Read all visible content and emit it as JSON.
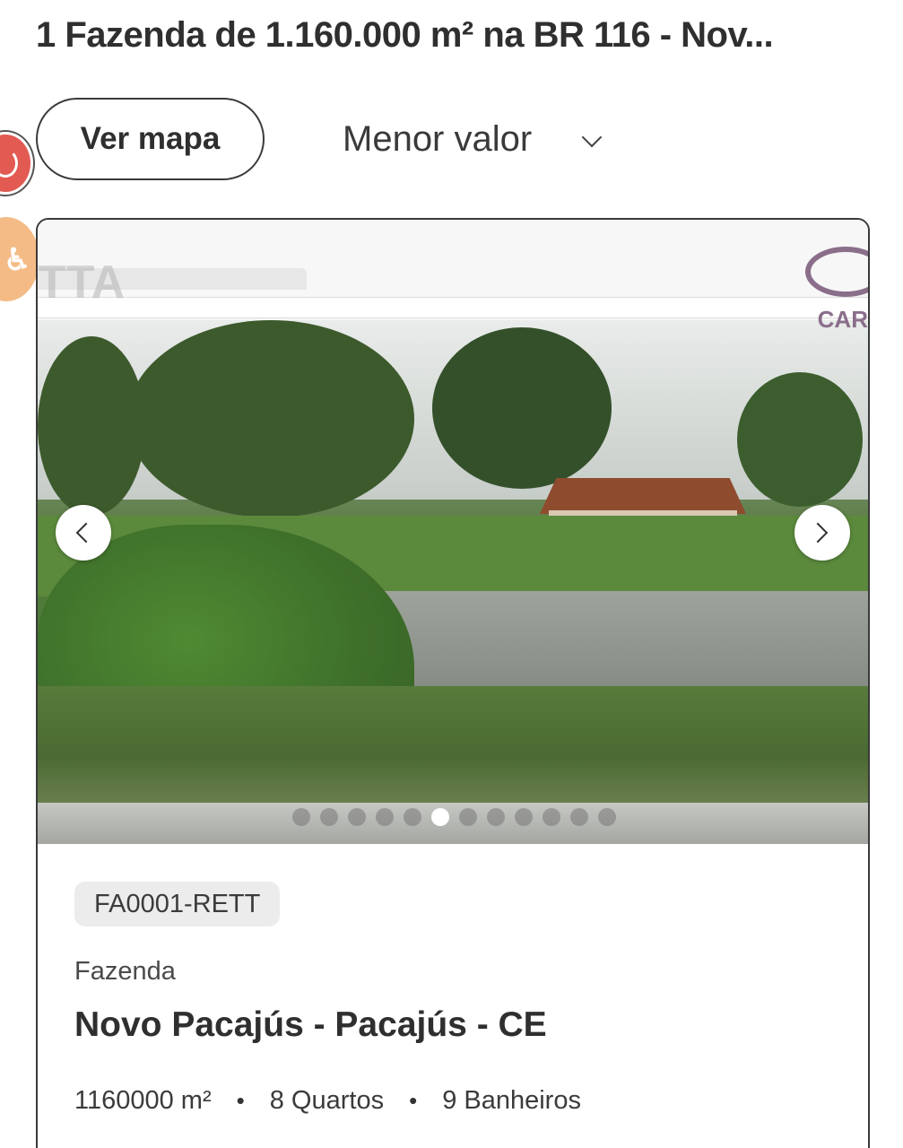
{
  "header": {
    "title": "1 Fazenda de 1.160.000 m² na BR 116 - Nov..."
  },
  "toolbar": {
    "map_button_label": "Ver mapa",
    "sort_selected": "Menor valor"
  },
  "listing": {
    "reference": "FA0001-RETT",
    "type": "Fazenda",
    "location": "Novo Pacajús - Pacajús - CE",
    "features": {
      "area": "1160000 m²",
      "bedrooms": "8 Quartos",
      "bathrooms": "9 Banheiros"
    },
    "photo": {
      "watermark": "TTA",
      "logo_text": "CAR",
      "total_slides": 12,
      "active_slide": 6
    }
  },
  "icons": {
    "prev": "chevron-left-icon",
    "next": "chevron-right-icon",
    "sort": "chevron-down-icon",
    "power_widget": "power-icon",
    "accessibility_widget": "accessibility-icon"
  }
}
